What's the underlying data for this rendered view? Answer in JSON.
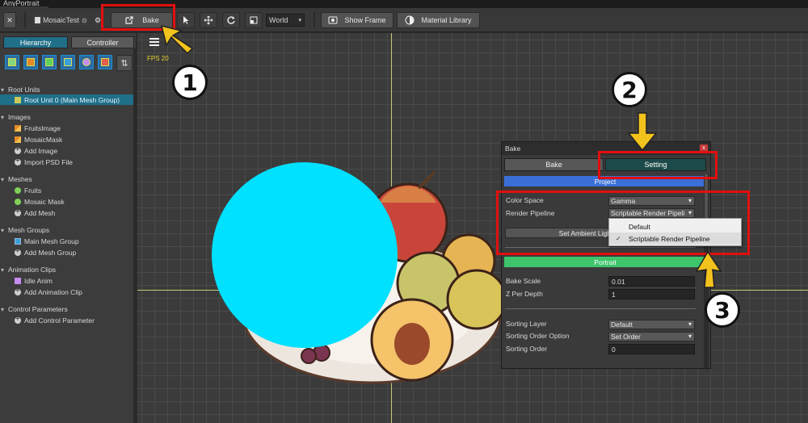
{
  "window": {
    "title": "AnyPortrait"
  },
  "toolbar": {
    "close_glyph": "✕",
    "file_name": "MosaicTest",
    "bake_label": "Bake",
    "space_value": "World",
    "show_frame_label": "Show Frame",
    "material_library_label": "Material Library"
  },
  "left_panel": {
    "tabs": [
      "Hierarchy",
      "Controller"
    ],
    "sort_glyph": "⇅",
    "sections": [
      {
        "title": "Root Units",
        "items": [
          {
            "label": "Root Unit 0 (Main Mesh Group)",
            "icon": "root-icon",
            "selected": true
          }
        ]
      },
      {
        "title": "Images",
        "items": [
          {
            "label": "FruitsImage",
            "icon": "image-icon"
          },
          {
            "label": "MosaicMask",
            "icon": "image-icon"
          },
          {
            "label": "Add Image",
            "icon": "add-icon"
          },
          {
            "label": "Import PSD File",
            "icon": "add-icon"
          }
        ]
      },
      {
        "title": "Meshes",
        "items": [
          {
            "label": "Fruits",
            "icon": "mesh-icon"
          },
          {
            "label": "Mosaic Mask",
            "icon": "mesh-icon"
          },
          {
            "label": "Add Mesh",
            "icon": "add-icon"
          }
        ]
      },
      {
        "title": "Mesh Groups",
        "items": [
          {
            "label": "Main Mesh Group",
            "icon": "mesh-group-icon"
          },
          {
            "label": "Add Mesh Group",
            "icon": "add-icon"
          }
        ]
      },
      {
        "title": "Animation Clips",
        "items": [
          {
            "label": "Idle Anim",
            "icon": "animation-icon"
          },
          {
            "label": "Add Animation Clip",
            "icon": "add-icon"
          }
        ]
      },
      {
        "title": "Control Parameters",
        "items": [
          {
            "label": "Add Control Parameter",
            "icon": "add-icon"
          }
        ]
      }
    ]
  },
  "viewport": {
    "fps_text": "FPS 20"
  },
  "bake_dialog": {
    "title": "Bake",
    "tabs": [
      "Bake",
      "Setting"
    ],
    "active_tab": "Setting",
    "project_header": "Project",
    "color_space_label": "Color Space",
    "color_space_value": "Gamma",
    "render_pipeline_label": "Render Pipeline",
    "render_pipeline_value": "Scriptable Render Pipeli",
    "set_ambient_label": "Set Ambient Light",
    "portrait_header": "Portrait",
    "bake_scale_label": "Bake Scale",
    "bake_scale_value": "0.01",
    "z_per_depth_label": "Z Per Depth",
    "z_per_depth_value": "1",
    "sorting_layer_label": "Sorting Layer",
    "sorting_layer_value": "Default",
    "sorting_order_option_label": "Sorting Order Option",
    "sorting_order_option_value": "Set Order",
    "sorting_order_label": "Sorting Order",
    "sorting_order_value": "0"
  },
  "pipeline_popup": {
    "options": [
      "Default",
      "Scriptable Render Pipeline"
    ],
    "selected": "Scriptable Render Pipeline"
  },
  "annotations": {
    "badge_1": "1",
    "badge_2": "2",
    "badge_3": "3"
  },
  "colors": {
    "selection": "#1f6f88",
    "project_header": "#3a6fd8",
    "portrait_header": "#3ec46b",
    "active_tab": "#1c4a4a",
    "annotation_red": "#e10f0f",
    "arrow_yellow": "#f3c31d",
    "mosaic_circle": "#00e0ff"
  }
}
